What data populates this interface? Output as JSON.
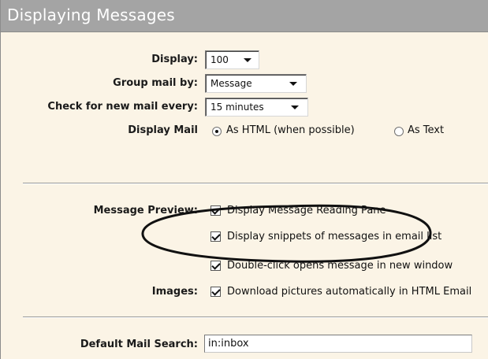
{
  "header": {
    "title": "Displaying Messages"
  },
  "settings": {
    "display": {
      "label": "Display:",
      "value": "100"
    },
    "group_mail_by": {
      "label": "Group mail by:",
      "value": "Message"
    },
    "check_new_mail": {
      "label": "Check for new mail every:",
      "value": "15 minutes"
    },
    "display_mail": {
      "label": "Display Mail",
      "options": [
        {
          "label": "As HTML (when possible)",
          "selected": true
        },
        {
          "label": "As Text",
          "selected": false
        }
      ]
    },
    "message_preview": {
      "label": "Message Preview:",
      "options": [
        {
          "label": "Display Message Reading Pane",
          "checked": true
        },
        {
          "label": "Display snippets of messages in email list",
          "checked": true
        },
        {
          "label": "Double-click opens message in new window",
          "checked": true
        }
      ]
    },
    "images": {
      "label": "Images:",
      "option": {
        "label": "Download pictures automatically in HTML Email",
        "checked": true
      }
    },
    "default_mail_search": {
      "label": "Default Mail Search:",
      "value": "in:inbox"
    }
  }
}
